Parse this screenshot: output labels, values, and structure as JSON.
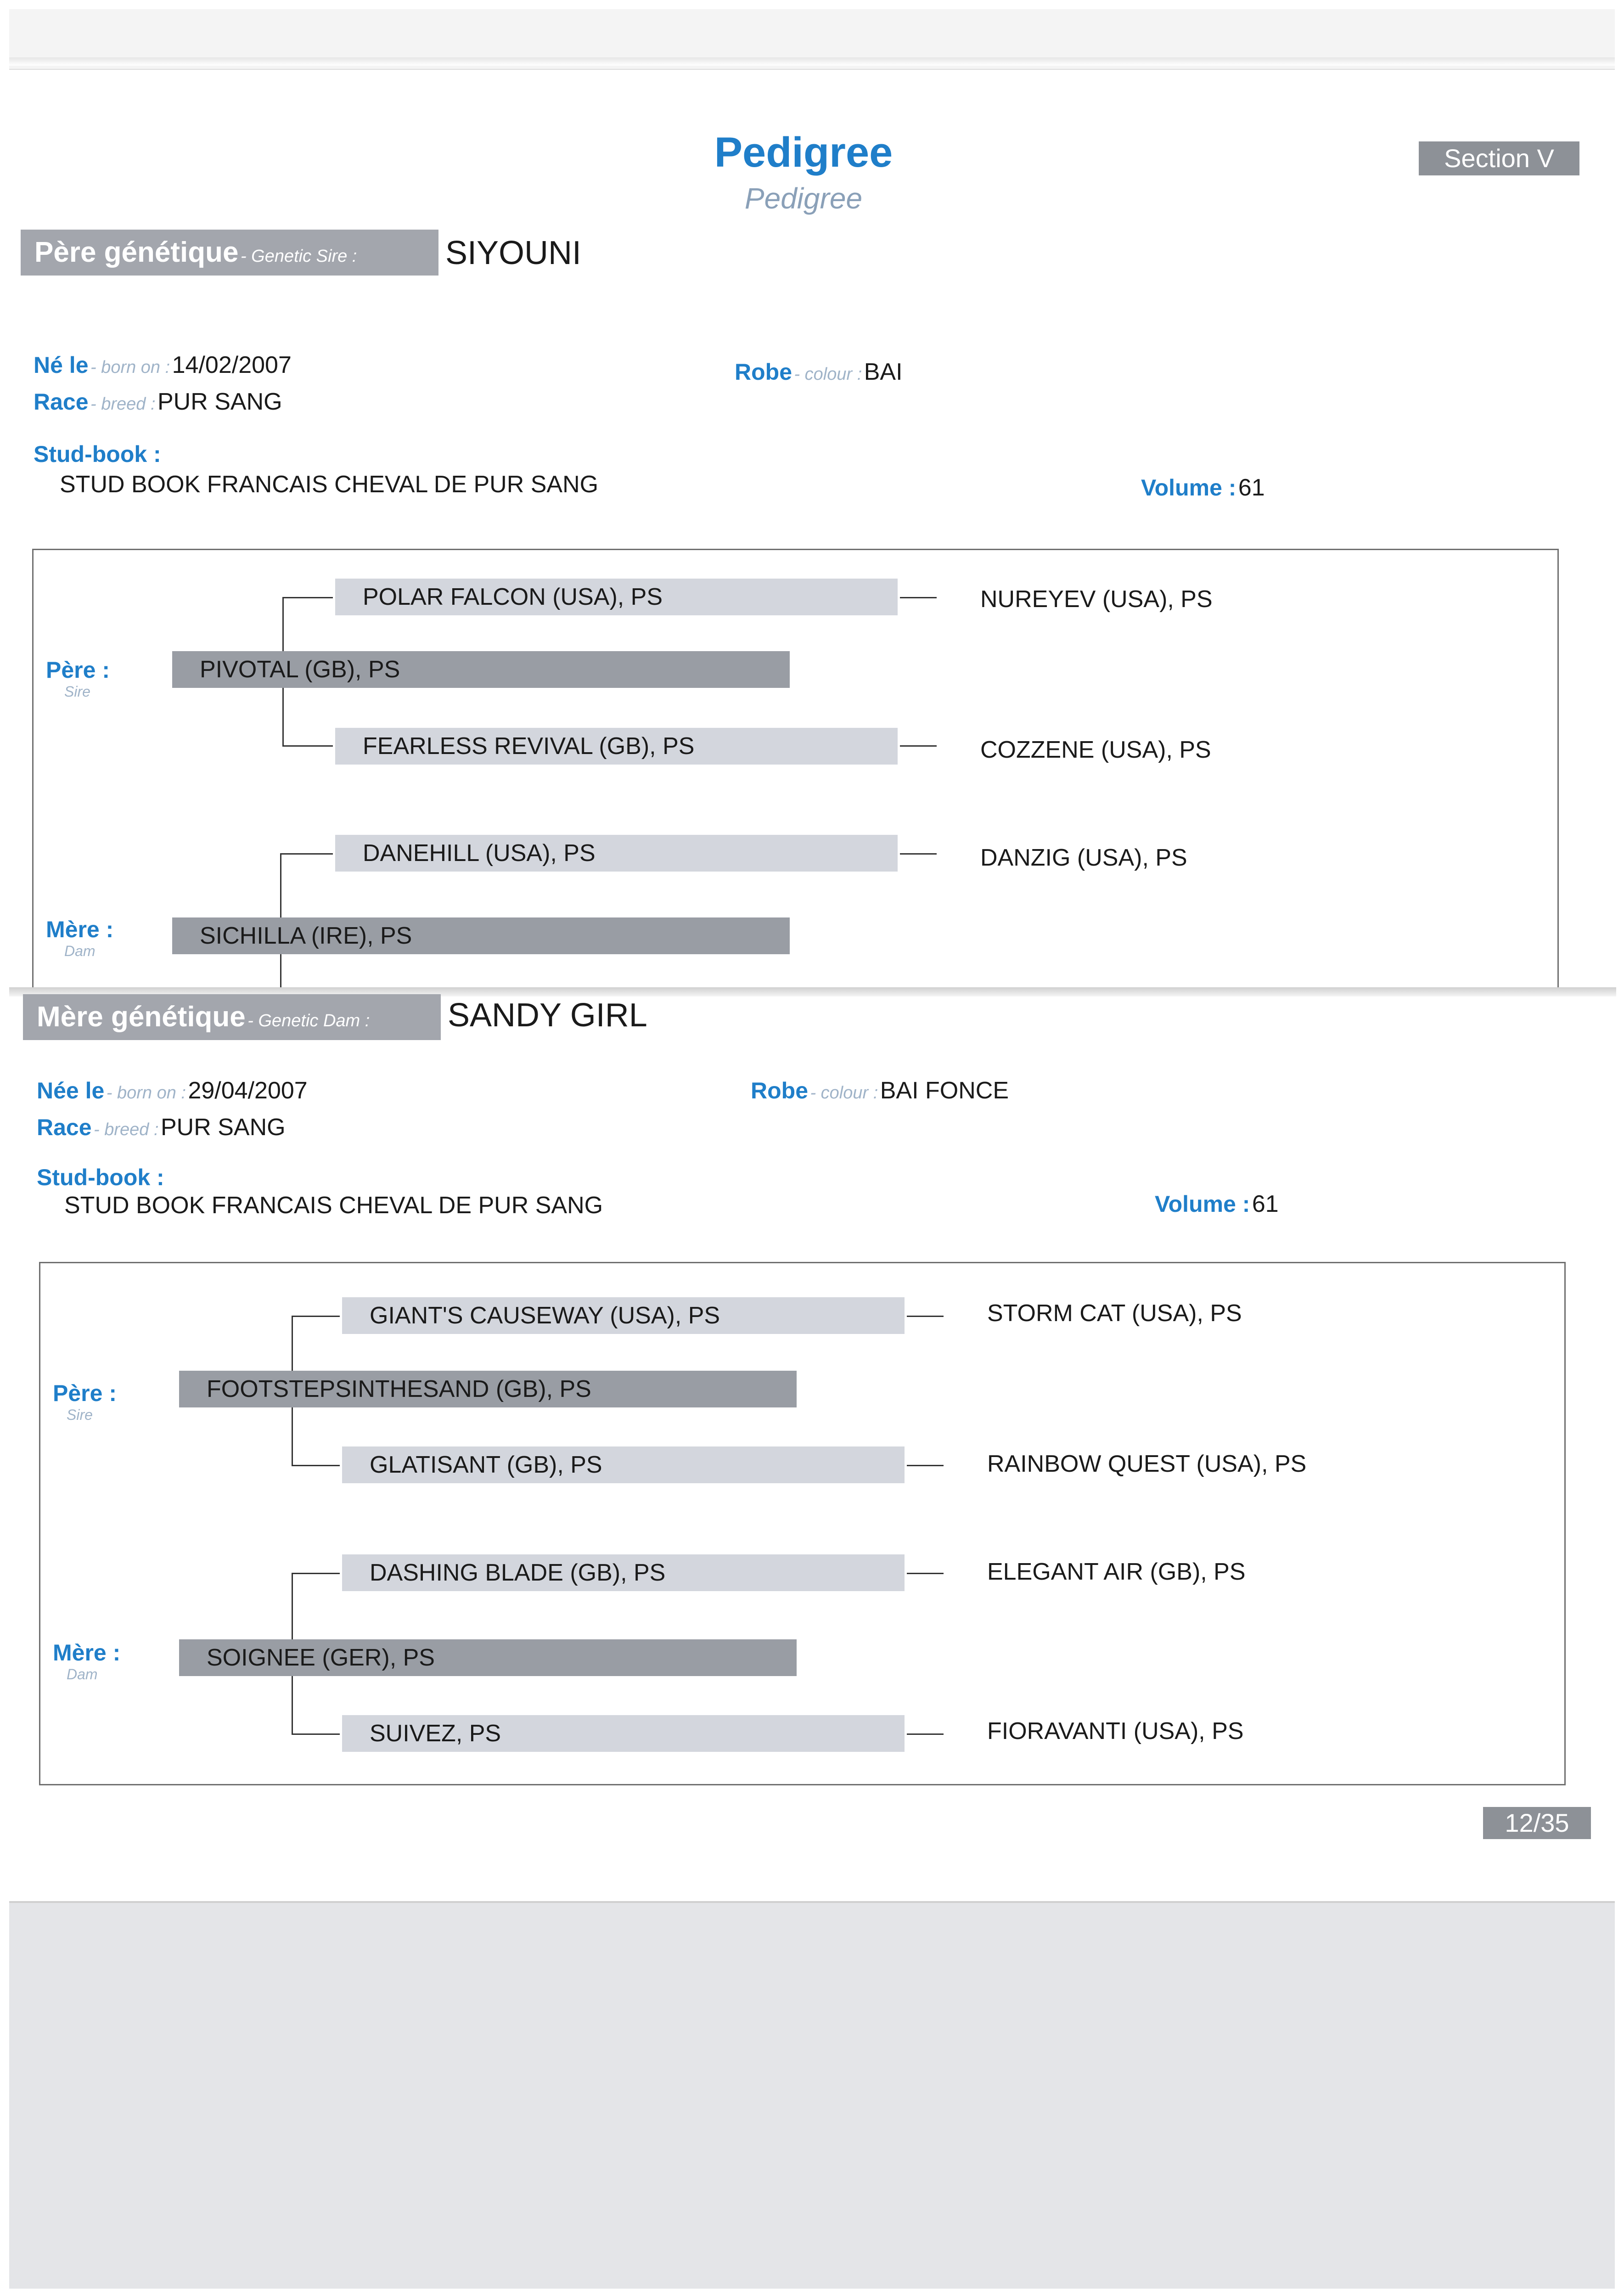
{
  "header": {
    "title": "Pedigree",
    "subtitle": "Pedigree",
    "section": "Section V"
  },
  "sire_block": {
    "label_fr": "Père génétique",
    "label_en": "- Genetic Sire :",
    "name": "SIYOUNI",
    "born_fr": "Né le",
    "born_en": "- born on :",
    "born": "14/02/2007",
    "breed_fr": "Race",
    "breed_en": "- breed :",
    "breed": "PUR SANG",
    "colour_fr": "Robe",
    "colour_en": "- colour :",
    "colour": "BAI",
    "studbook_label": "Stud-book :",
    "studbook": "STUD BOOK FRANCAIS CHEVAL DE PUR SANG",
    "volume_label": "Volume :",
    "volume": "61",
    "sire_label": "Père :",
    "sire_en": "Sire",
    "dam_label": "Mère :",
    "dam_en": "Dam",
    "sire": "PIVOTAL (GB), PS",
    "sire_sire": "POLAR FALCON (USA), PS",
    "sire_sire_sire": "NUREYEV (USA), PS",
    "sire_dam": "FEARLESS REVIVAL (GB), PS",
    "sire_dam_sire": "COZZENE (USA), PS",
    "dam": "SICHILLA (IRE), PS",
    "dam_sire": "DANEHILL (USA), PS",
    "dam_sire_sire": "DANZIG (USA), PS"
  },
  "dam_block": {
    "label_fr": "Mère génétique",
    "label_en": "- Genetic Dam :",
    "name": "SANDY GIRL",
    "born_fr": "Née le",
    "born_en": "- born on :",
    "born": "29/04/2007",
    "breed_fr": "Race",
    "breed_en": "- breed :",
    "breed": "PUR SANG",
    "colour_fr": "Robe",
    "colour_en": "- colour :",
    "colour": "BAI FONCE",
    "studbook_label": "Stud-book :",
    "studbook": "STUD BOOK FRANCAIS CHEVAL DE PUR SANG",
    "volume_label": "Volume :",
    "volume": "61",
    "sire_label": "Père :",
    "sire_en": "Sire",
    "dam_label": "Mère :",
    "dam_en": "Dam",
    "sire": "FOOTSTEPSINTHESAND (GB), PS",
    "sire_sire": "GIANT'S CAUSEWAY (USA), PS",
    "sire_sire_sire": "STORM CAT (USA), PS",
    "sire_dam": "GLATISANT (GB), PS",
    "sire_dam_sire": "RAINBOW QUEST (USA), PS",
    "dam": "SOIGNEE (GER), PS",
    "dam_sire": "DASHING BLADE (GB), PS",
    "dam_sire_sire": "ELEGANT AIR (GB), PS",
    "dam_dam": "SUIVEZ, PS",
    "dam_dam_sire": "FIORAVANTI (USA), PS"
  },
  "footer": {
    "page": "12/35"
  }
}
